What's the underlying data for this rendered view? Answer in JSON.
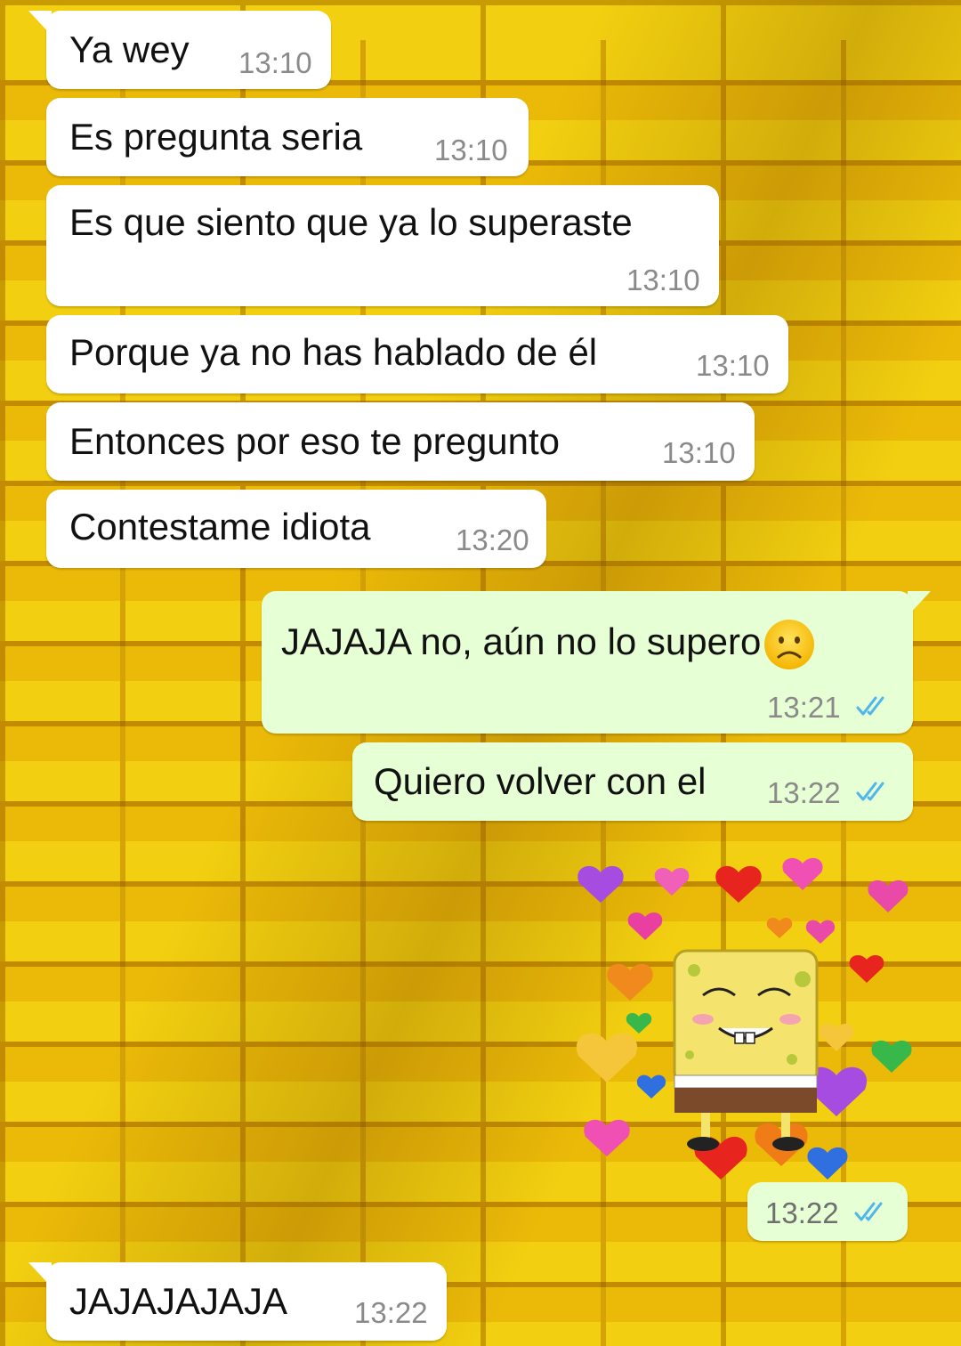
{
  "messages": [
    {
      "text": "Ya wey",
      "time": "13:10",
      "dir": "in"
    },
    {
      "text": "Es pregunta seria",
      "time": "13:10",
      "dir": "in"
    },
    {
      "text": "Es que siento que ya lo superaste",
      "time": "13:10",
      "dir": "in"
    },
    {
      "text": "Porque ya no has hablado de él",
      "time": "13:10",
      "dir": "in"
    },
    {
      "text": "Entonces por eso te pregunto",
      "time": "13:10",
      "dir": "in"
    },
    {
      "text": "Contestame idiota",
      "time": "13:20",
      "dir": "in"
    },
    {
      "text": "JAJAJA no, aún no lo supero",
      "time": "13:21",
      "dir": "out",
      "emoji": "sad-face-emoji"
    },
    {
      "text": "Quiero volver con el",
      "time": "13:22",
      "dir": "out"
    },
    {
      "sticker": "spongebob-hearts-sticker",
      "time": "13:22",
      "dir": "out"
    },
    {
      "text": "JAJAJAJAJA",
      "time": "13:22",
      "dir": "in"
    }
  ],
  "colors": {
    "incoming_bubble": "#ffffff",
    "outgoing_bubble": "#e6ffd4",
    "read_ticks": "#4fb6ec",
    "wallpaper": "#f2cf10"
  },
  "status_icon": "double-check-read-icon"
}
